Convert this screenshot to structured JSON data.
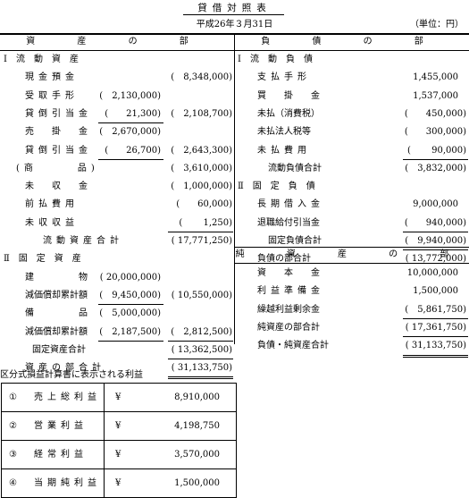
{
  "title": "貸借対照表",
  "date": "平成26年３月31日",
  "unit": "（単位：円）",
  "assets": {
    "header": "資 産 の 部",
    "current_title": "Ⅰ流動資産",
    "rows": [
      {
        "label": "現金預金",
        "col1": "",
        "col2": "(　8,348,000)"
      },
      {
        "label": "受取手形",
        "col1": "(　2,130,000)",
        "col2": ""
      },
      {
        "label": "貸倒引当金",
        "col1": "(　　21,300)",
        "col2": "(　2,108,700)"
      },
      {
        "label": "売　掛　金",
        "col1": "(　2,670,000)",
        "col2": ""
      },
      {
        "label": "貸倒引当金",
        "col1": "(　　26,700)",
        "col2": "(　2,643,300)"
      },
      {
        "label": "(商　　　品)",
        "col1": "",
        "col2": "(　3,610,000)"
      },
      {
        "label": "未　収　金",
        "col1": "",
        "col2": "(　1,000,000)"
      },
      {
        "label": "前払費用",
        "col1": "",
        "col2": "(　　60,000)"
      },
      {
        "label": "未収収益",
        "col1": "",
        "col2": "(　　 1,250)"
      },
      {
        "label": "流動資産合計",
        "col1": "",
        "col2": "( 17,771,250)"
      }
    ],
    "fixed_title": "Ⅱ固定資産",
    "fixed_rows": [
      {
        "label": "建　　　物",
        "col1": "( 20,000,000)",
        "col2": ""
      },
      {
        "label": "減価償却累計額",
        "col1": "(　9,450,000)",
        "col2": "( 10,550,000)"
      },
      {
        "label": "備　　　品",
        "col1": "(　5,000,000)",
        "col2": ""
      },
      {
        "label": "減価償却累計額",
        "col1": "(　2,187,500)",
        "col2": "(　2,812,500)"
      },
      {
        "label": "固定資産合計",
        "col1": "",
        "col2": "( 13,362,500)"
      }
    ],
    "total_label": "資産の部合計",
    "total_value": "( 31,133,750)"
  },
  "liabilities": {
    "header": "負 債 の 部",
    "current_title": "Ⅰ流動負債",
    "rows": [
      {
        "label": "支払手形",
        "value": "1,455,000"
      },
      {
        "label": "買　掛　金",
        "value": "1,537,000"
      },
      {
        "label": "未払（消費税）",
        "value": "(　　450,000)"
      },
      {
        "label": "未払法人税等",
        "value": "(　　300,000)"
      },
      {
        "label": "未払費用",
        "value": "(　　 90,000)"
      },
      {
        "label": "流動負債合計",
        "value": "(　3,832,000)"
      }
    ],
    "fixed_title": "Ⅱ固定負債",
    "fixed_rows": [
      {
        "label": "長期借入金",
        "value": "9,000,000"
      },
      {
        "label": "退職給付引当金",
        "value": "(　　940,000)"
      },
      {
        "label": "固定負債合計",
        "value": "(　9,940,000)"
      }
    ],
    "total_label": "負債の部合計",
    "total_value": "( 13,772,000)"
  },
  "net_assets": {
    "header": "純 資 産 の 部",
    "rows": [
      {
        "label": "資　本　金",
        "value": "10,000,000"
      },
      {
        "label": "利益準備金",
        "value": "1,500,000"
      },
      {
        "label": "繰越利益剰余金",
        "value": "(　5,861,750)"
      },
      {
        "label": "純資産の部合計",
        "value": "( 17,361,750)"
      },
      {
        "label": "負債・純資産合計",
        "value": "( 31,133,750)"
      }
    ]
  },
  "profit": {
    "caption": "区分式損益計算書に表示される利益",
    "rows": [
      {
        "no": "①",
        "label": "売上総利益",
        "yen": "¥",
        "value": "8,910,000"
      },
      {
        "no": "②",
        "label": "営業利益",
        "yen": "¥",
        "value": "4,198,750"
      },
      {
        "no": "③",
        "label": "経常利益",
        "yen": "¥",
        "value": "3,570,000"
      },
      {
        "no": "④",
        "label": "当期純利益",
        "yen": "¥",
        "value": "1,500,000"
      }
    ]
  }
}
